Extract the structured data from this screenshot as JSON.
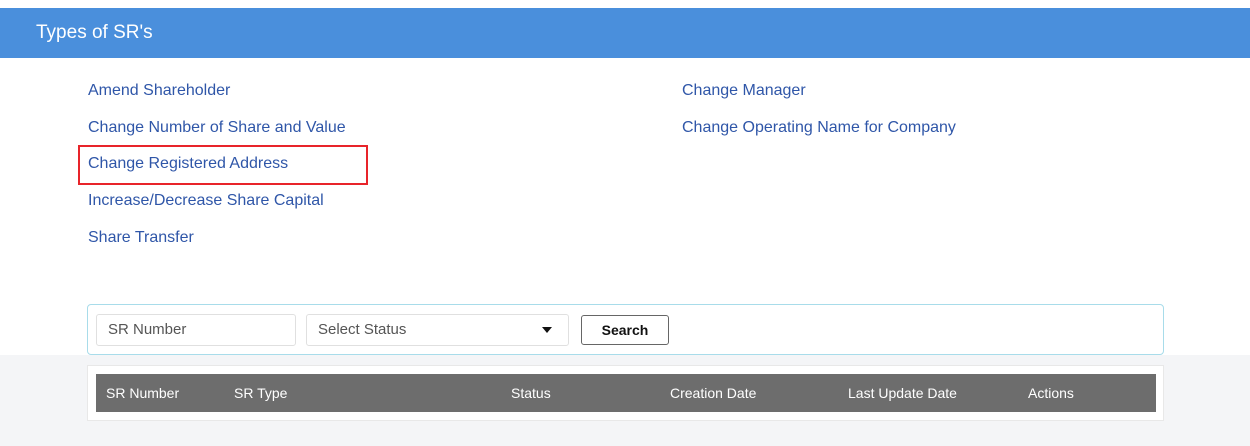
{
  "header": {
    "title": "Types of SR's"
  },
  "sr_types": {
    "left": [
      "Amend Shareholder",
      "Change Number of Share and Value",
      "Change Registered Address",
      "Increase/Decrease Share Capital",
      "Share Transfer"
    ],
    "right": [
      "Change Manager",
      "Change Operating Name for Company"
    ],
    "highlighted": "Change Registered Address",
    "highlight_color": "#e8242a",
    "link_color": "#2f56a8"
  },
  "filter": {
    "sr_number_placeholder": "SR Number",
    "status_selected": "Select Status",
    "search_label": "Search"
  },
  "table": {
    "columns": [
      "SR Number",
      "SR Type",
      "Status",
      "Creation Date",
      "Last Update Date",
      "Actions"
    ]
  },
  "colors": {
    "header_bg": "#4a8fdc",
    "table_header_bg": "#6d6d6d"
  }
}
